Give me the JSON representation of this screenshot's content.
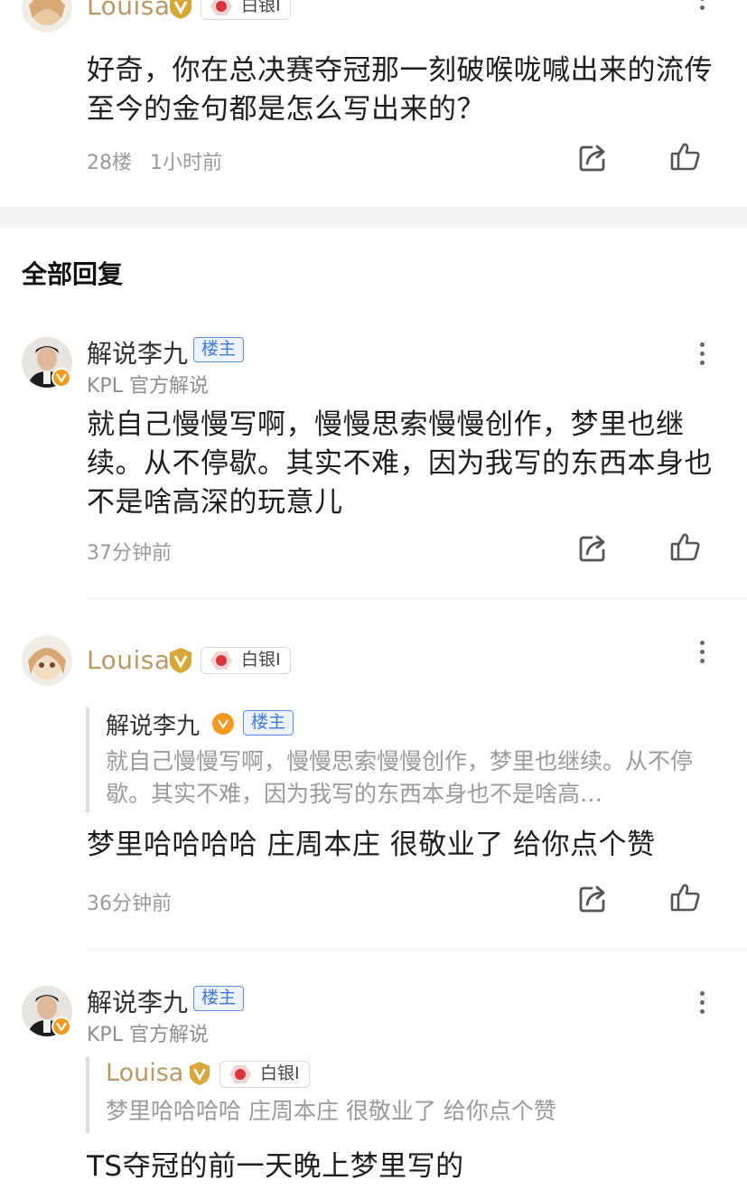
{
  "top_post": {
    "user_name": "Louisa",
    "rank_label": "白银I",
    "content": "好奇，你在总决赛夺冠那一刻破喉咙喊出来的流传至今的金句都是怎么写出来的？",
    "floor": "28楼",
    "time": "1小时前"
  },
  "section_title": "全部回复",
  "replies": [
    {
      "user_name": "解说李九",
      "host_tag": "楼主",
      "subtitle": "KPL 官方解说",
      "content": "就自己慢慢写啊，慢慢思索慢慢创作，梦里也继续。从不停歇。其实不难，因为我写的东西本身也不是啥高深的玩意儿",
      "time": "37分钟前"
    },
    {
      "user_name": "Louisa",
      "rank_label": "白银I",
      "quote": {
        "user_name": "解说李九",
        "host_tag": "楼主",
        "text": "就自己慢慢写啊，慢慢思索慢慢创作，梦里也继续。从不停歇。其实不难，因为我写的东西本身也不是啥高…"
      },
      "content": "梦里哈哈哈哈 庄周本庄 很敬业了 给你点个赞",
      "time": "36分钟前"
    },
    {
      "user_name": "解说李九",
      "host_tag": "楼主",
      "subtitle": "KPL 官方解说",
      "quote": {
        "user_name": "Louisa",
        "rank_label": "白银I",
        "text": "梦里哈哈哈哈 庄周本庄 很敬业了 给你点个赞"
      },
      "content": "TS夺冠的前一天晚上梦里写的"
    }
  ],
  "icons": {
    "share": "share-icon",
    "like": "thumbs-up-icon",
    "more": "more-vertical-icon",
    "verified": "verified-v-icon",
    "rank": "rank-emblem-icon"
  },
  "colors": {
    "host_tag": "#3f78dd",
    "gold_name": "#b89a66",
    "verified_orange": "#f29a1f"
  }
}
